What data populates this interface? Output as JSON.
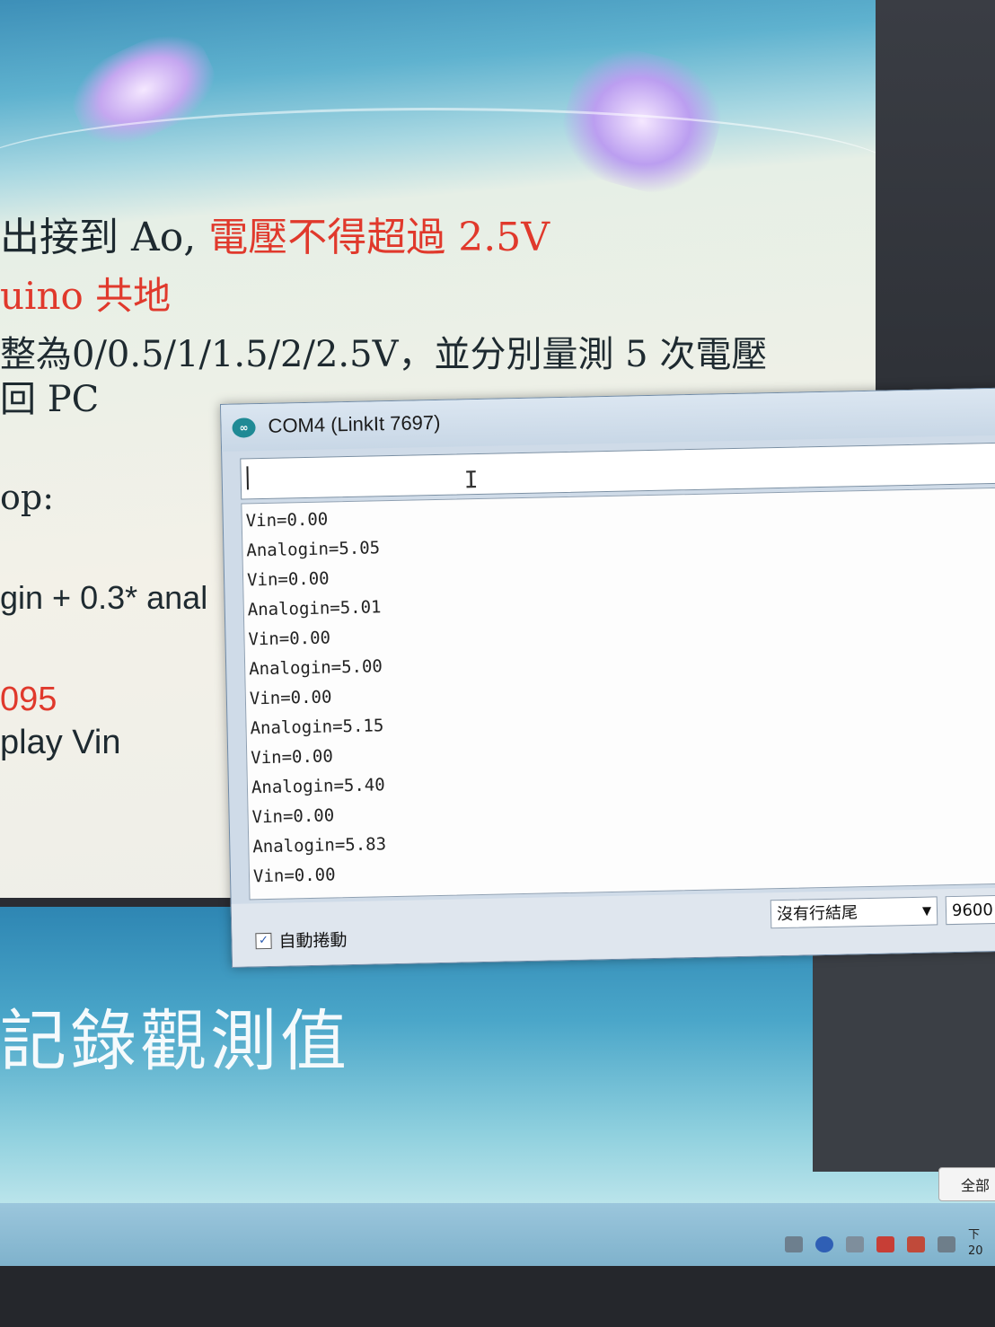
{
  "slide": {
    "line1_dark": "出接到 Ao, ",
    "line1_red": "電壓不得超過 2.5V",
    "line2": "uino 共地",
    "line3": "整為0/0.5/1/1.5/2/2.5V，並分別量測 5 次電壓",
    "line4": "回 PC",
    "line5": "op:",
    "line6": "gin + 0.3* anal",
    "line7": "095",
    "line8": "play Vin"
  },
  "slide2": {
    "title": "記錄觀測值",
    "button_label": "全部"
  },
  "window": {
    "title": "COM4 (LinkIt 7697)",
    "input_value": "",
    "output_lines": [
      "Vin=0.00",
      "Analogin=5.05",
      "Vin=0.00",
      "Analogin=5.01",
      "Vin=0.00",
      "Analogin=5.00",
      "Vin=0.00",
      "Analogin=5.15",
      "Vin=0.00",
      "Analogin=5.40",
      "Vin=0.00",
      "Analogin=5.83",
      "Vin=0.00"
    ],
    "autoscroll_label": "自動捲動",
    "autoscroll_checked": true,
    "line_ending": "沒有行結尾",
    "baud": "9600"
  },
  "taskbar": {
    "clock_text": "下",
    "date_text": "20"
  }
}
